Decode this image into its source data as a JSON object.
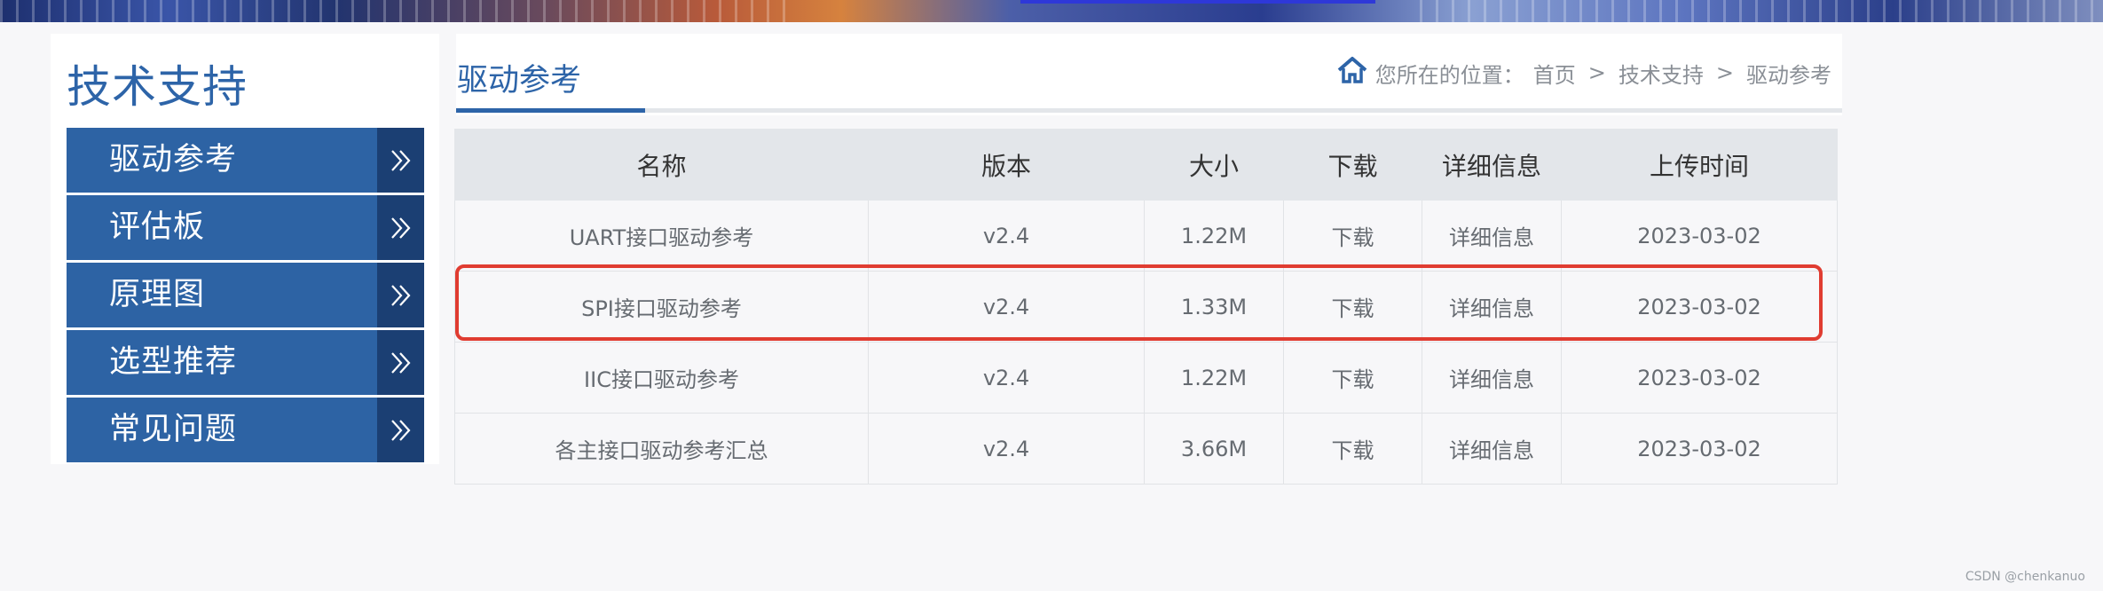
{
  "sidebar": {
    "title": "技术支持",
    "items": [
      {
        "label": "驱动参考"
      },
      {
        "label": "评估板"
      },
      {
        "label": "原理图"
      },
      {
        "label": "选型推荐"
      },
      {
        "label": "常见问题"
      }
    ],
    "arrow_icon": "double-chevron-right-icon",
    "colors": {
      "item_bg": "#2d63a4",
      "arrow_bg": "#1b3f73"
    }
  },
  "main": {
    "title": "驱动参考",
    "breadcrumb": {
      "icon": "home-icon",
      "prefix": "您所在的位置：",
      "items": [
        "首页",
        "技术支持",
        "驱动参考"
      ],
      "separator": ">"
    }
  },
  "table": {
    "headers": [
      "名称",
      "版本",
      "大小",
      "下载",
      "详细信息",
      "上传时间"
    ],
    "rows": [
      [
        "UART接口驱动参考",
        "v2.4",
        "1.22M",
        "下载",
        "详细信息",
        "2023-03-02"
      ],
      [
        "SPI接口驱动参考",
        "v2.4",
        "1.33M",
        "下载",
        "详细信息",
        "2023-03-02"
      ],
      [
        "IIC接口驱动参考",
        "v2.4",
        "1.22M",
        "下载",
        "详细信息",
        "2023-03-02"
      ],
      [
        "各主接口驱动参考汇总",
        "v2.4",
        "3.66M",
        "下载",
        "详细信息",
        "2023-03-02"
      ]
    ],
    "highlighted_row": 1,
    "highlight_color": "#e03c31"
  },
  "watermark": "CSDN @chenkanuo",
  "colors": {
    "accent": "#2d64a8",
    "header_bg": "#e3e6ea",
    "page_bg": "#f7f7f9"
  }
}
